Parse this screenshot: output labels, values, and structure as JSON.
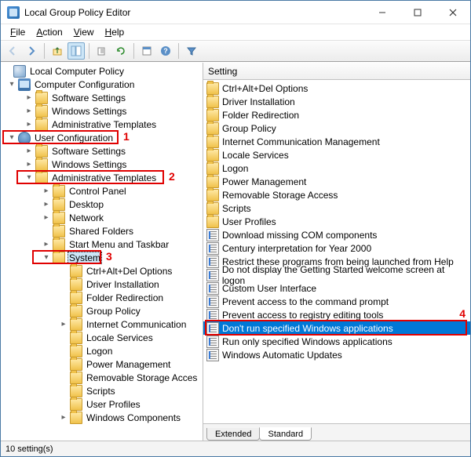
{
  "window": {
    "title": "Local Group Policy Editor"
  },
  "menus": [
    "File",
    "Action",
    "View",
    "Help"
  ],
  "toolbar_icons": [
    "back",
    "forward",
    "up",
    "tree-toggle",
    "copy",
    "delete",
    "refresh",
    "properties",
    "help",
    "filter"
  ],
  "tree": {
    "root": {
      "label": "Local Computer Policy"
    },
    "computer_config": {
      "label": "Computer Configuration"
    },
    "cc_children": [
      "Software Settings",
      "Windows Settings",
      "Administrative Templates"
    ],
    "user_config": {
      "label": "User Configuration"
    },
    "uc_children": [
      "Software Settings",
      "Windows Settings",
      "Administrative Templates"
    ],
    "admin_tpl_children": [
      "Control Panel",
      "Desktop",
      "Network",
      "Shared Folders",
      "Start Menu and Taskbar",
      "System"
    ],
    "system_children": [
      "Ctrl+Alt+Del Options",
      "Driver Installation",
      "Folder Redirection",
      "Group Policy",
      "Internet Communication",
      "Locale Services",
      "Logon",
      "Power Management",
      "Removable Storage Acces",
      "Scripts",
      "User Profiles",
      "Windows Components"
    ],
    "selected": "System"
  },
  "annotations": {
    "1": "1",
    "2": "2",
    "3": "3",
    "4": "4"
  },
  "list": {
    "header": "Setting",
    "selected_index": 18,
    "items": [
      {
        "type": "folder",
        "label": "Ctrl+Alt+Del Options"
      },
      {
        "type": "folder",
        "label": "Driver Installation"
      },
      {
        "type": "folder",
        "label": "Folder Redirection"
      },
      {
        "type": "folder",
        "label": "Group Policy"
      },
      {
        "type": "folder",
        "label": "Internet Communication Management"
      },
      {
        "type": "folder",
        "label": "Locale Services"
      },
      {
        "type": "folder",
        "label": "Logon"
      },
      {
        "type": "folder",
        "label": "Power Management"
      },
      {
        "type": "folder",
        "label": "Removable Storage Access"
      },
      {
        "type": "folder",
        "label": "Scripts"
      },
      {
        "type": "folder",
        "label": "User Profiles"
      },
      {
        "type": "setting",
        "label": "Download missing COM components"
      },
      {
        "type": "setting",
        "label": "Century interpretation for Year 2000"
      },
      {
        "type": "setting",
        "label": "Restrict these programs from being launched from Help"
      },
      {
        "type": "setting",
        "label": "Do not display the Getting Started welcome screen at logon"
      },
      {
        "type": "setting",
        "label": "Custom User Interface"
      },
      {
        "type": "setting",
        "label": "Prevent access to the command prompt"
      },
      {
        "type": "setting",
        "label": "Prevent access to registry editing tools"
      },
      {
        "type": "setting",
        "label": "Don't run specified Windows applications"
      },
      {
        "type": "setting",
        "label": "Run only specified Windows applications"
      },
      {
        "type": "setting",
        "label": "Windows Automatic Updates"
      }
    ]
  },
  "tabs": {
    "extended": "Extended",
    "standard": "Standard",
    "active": "standard"
  },
  "status": "10 setting(s)"
}
